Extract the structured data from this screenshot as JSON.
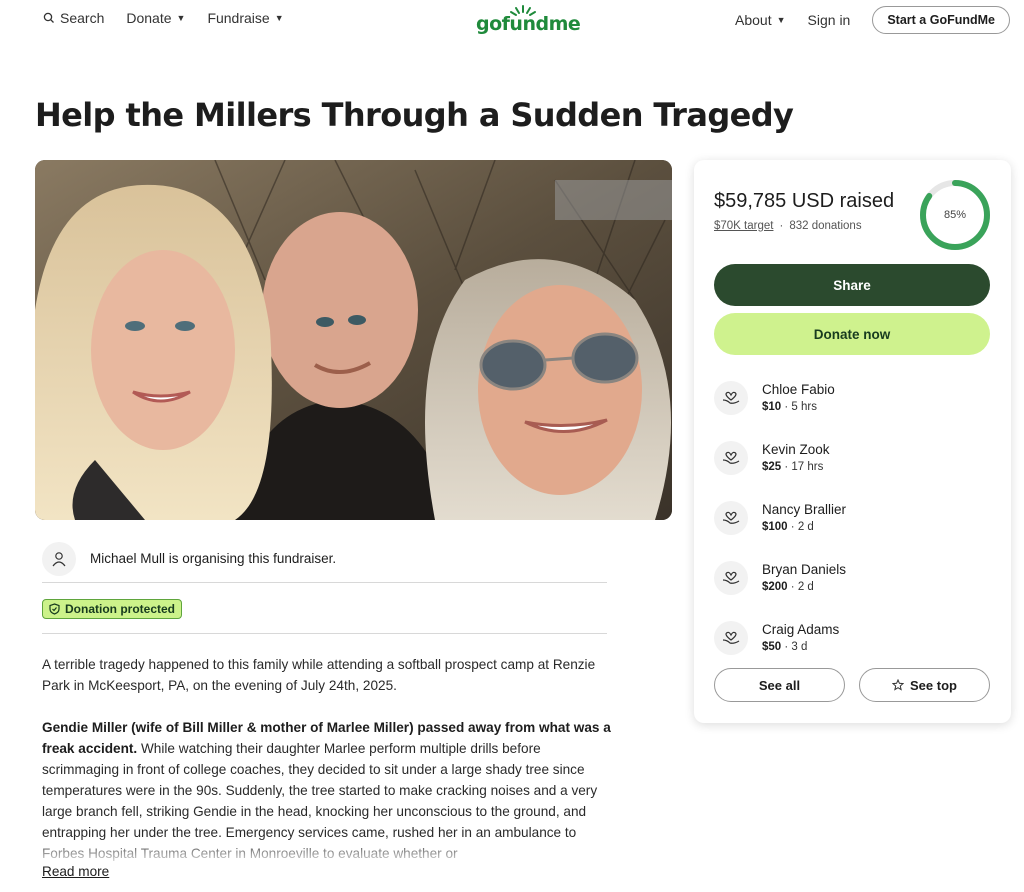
{
  "nav": {
    "search_label": "Search",
    "donate_label": "Donate",
    "fundraise_label": "Fundraise",
    "about_label": "About",
    "signin_label": "Sign in",
    "start_label": "Start a GoFundMe",
    "logo_text": "gofundme"
  },
  "campaign": {
    "title": "Help the Millers Through a Sudden Tragedy",
    "organizer_text": "Michael Mull is organising this fundraiser.",
    "protected_label": "Donation protected",
    "story_p1": "A terrible tragedy happened to this family while attending a softball prospect camp at Renzie Park in McKeesport, PA, on the evening of July 24th, 2025.",
    "story_p2_bold": "Gendie Miller (wife of Bill Miller & mother of Marlee Miller) passed away from what was a freak accident.",
    "story_p2_rest": " While watching their daughter Marlee perform multiple drills before scrimmaging in front of college coaches, they decided to sit under a large shady tree since temperatures were in the 90s. Suddenly, the tree started to make cracking noises and a very large branch fell, striking Gendie in the head, knocking her unconscious to the ground, and entrapping her under the tree. Emergency services came, rushed her in an ambulance to Forbes Hospital Trauma Center in Monroeville to evaluate whether or",
    "read_more": "Read more"
  },
  "donation_card": {
    "raised_text": "$59,785 USD raised",
    "target_text": "$70K target",
    "separator": "·",
    "donations_text": "832 donations",
    "progress_fraction": 0.85,
    "progress_label": "85%",
    "share_label": "Share",
    "donate_label": "Donate now",
    "see_all_label": "See all",
    "see_top_label": "See top"
  },
  "donors": [
    {
      "name": "Chloe Fabio",
      "amount": "$10",
      "time": "· 5 hrs"
    },
    {
      "name": "Kevin Zook",
      "amount": "$25",
      "time": "· 17 hrs"
    },
    {
      "name": "Nancy Brallier",
      "amount": "$100",
      "time": "· 2 d"
    },
    {
      "name": "Bryan Daniels",
      "amount": "$200",
      "time": "· 2 d"
    },
    {
      "name": "Craig Adams",
      "amount": "$50",
      "time": "· 3 d"
    }
  ],
  "colors": {
    "brand_green": "#1f8a3b",
    "share_bg": "#2b4a2e",
    "donate_bg": "#cff28e",
    "progress_green": "#3aa35a"
  }
}
